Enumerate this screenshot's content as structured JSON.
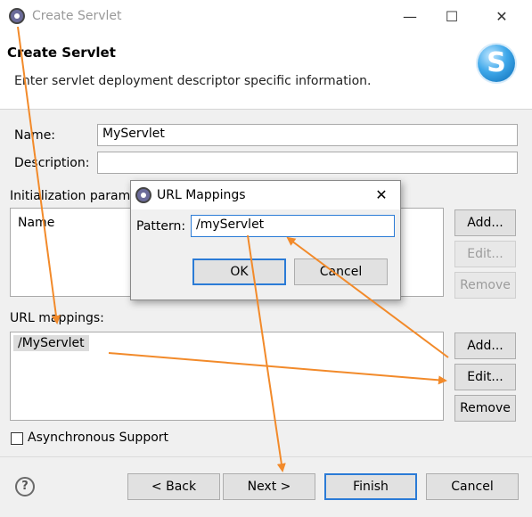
{
  "window": {
    "title": "Create Servlet"
  },
  "header": {
    "title": "Create Servlet",
    "description": "Enter servlet deployment descriptor specific information.",
    "logo_letter": "S"
  },
  "form": {
    "name_label": "Name:",
    "name_value": "MyServlet",
    "description_label": "Description:",
    "description_value": "",
    "init_params_label": "Initialization param",
    "init_params_columns": [
      "Name"
    ],
    "init_buttons": {
      "add": "Add...",
      "edit": "Edit...",
      "remove": "Remove"
    },
    "url_mappings_label": "URL mappings:",
    "url_mappings": [
      "/MyServlet"
    ],
    "url_buttons": {
      "add": "Add...",
      "edit": "Edit...",
      "remove": "Remove"
    },
    "async_label": "Asynchronous Support"
  },
  "footer": {
    "help": "?",
    "back": "< Back",
    "next": "Next >",
    "finish": "Finish",
    "cancel": "Cancel"
  },
  "dialog": {
    "title": "URL Mappings",
    "pattern_label": "Pattern:",
    "pattern_value": "/myServlet",
    "ok": "OK",
    "cancel": "Cancel"
  },
  "colors": {
    "annotation_arrow": "#f28a2a",
    "accent": "#2b7bd6"
  }
}
